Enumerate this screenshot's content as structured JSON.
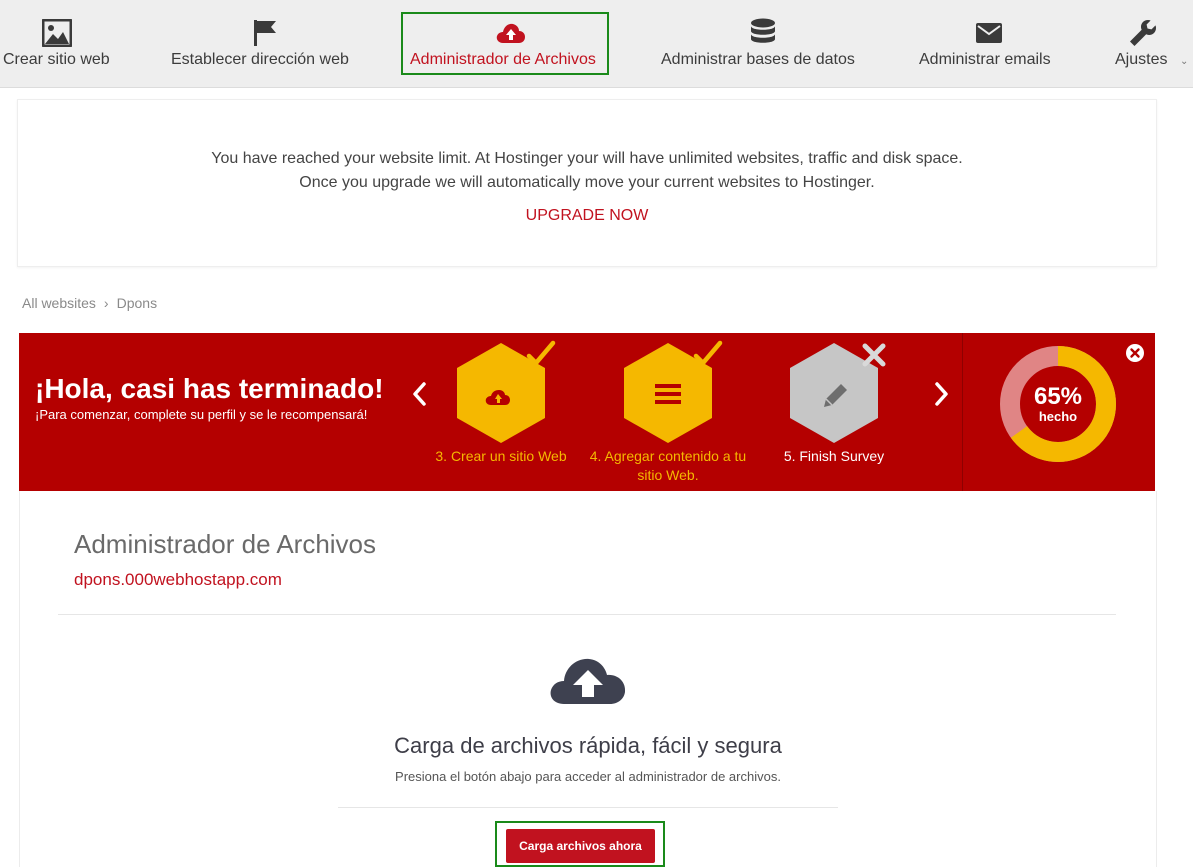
{
  "nav": {
    "items": [
      {
        "label": "Crear sitio web",
        "icon": "image-icon"
      },
      {
        "label": "Establecer dirección web",
        "icon": "flag-icon"
      },
      {
        "label": "Administrador de Archivos",
        "icon": "cloud-upload-icon",
        "active": true
      },
      {
        "label": "Administrar bases de datos",
        "icon": "database-icon"
      },
      {
        "label": "Administrar emails",
        "icon": "envelope-icon"
      },
      {
        "label": "Ajustes",
        "icon": "wrench-icon"
      }
    ]
  },
  "upgrade": {
    "line1": "You have reached your website limit. At Hostinger your will have unlimited websites, traffic and disk space.",
    "line2": "Once you upgrade we will automatically move your current websites to Hostinger.",
    "link": "UPGRADE NOW"
  },
  "breadcrumb": {
    "root": "All websites",
    "separator": "›",
    "current": "Dpons"
  },
  "banner": {
    "title": "¡Hola, casi has terminado!",
    "subtitle": "¡Para comenzar, complete su perfil y se le recompensará!",
    "steps": [
      {
        "label": "3. Crear un sitio Web",
        "status": "done",
        "icon": "cloud-upload-icon"
      },
      {
        "label": "4. Agregar contenido a tu sitio Web.",
        "status": "done",
        "icon": "list-icon"
      },
      {
        "label": "5. Finish Survey",
        "status": "todo",
        "icon": "pencil-icon"
      }
    ],
    "progress": {
      "percent_text": "65%",
      "caption": "hecho",
      "value": 0.65
    }
  },
  "main": {
    "title": "Administrador de Archivos",
    "domain": "dpons.000webhostapp.com",
    "upload_title": "Carga de archivos rápida, fácil y segura",
    "upload_desc": "Presiona el botón abajo para acceder al administrador de archivos.",
    "button": "Carga archivos ahora"
  },
  "colors": {
    "brand_red": "#c1121f",
    "banner_red": "#b40000",
    "yellow": "#f5b800",
    "highlight_green": "#1a8a1a"
  }
}
